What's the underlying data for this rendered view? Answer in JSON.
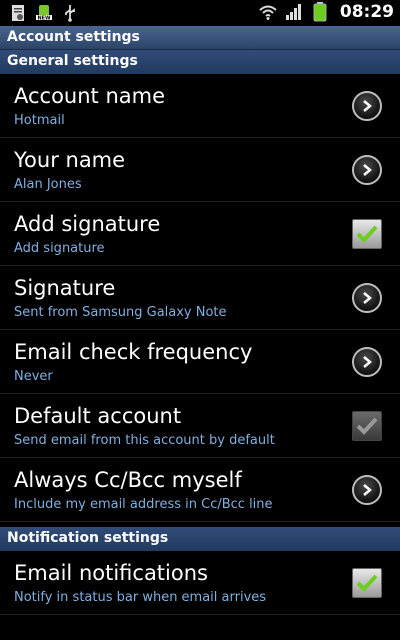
{
  "status_bar": {
    "time": "08:29",
    "left_icons": [
      "document-icon",
      "news-icon",
      "usb-icon"
    ],
    "right_icons": [
      "wifi-icon",
      "signal-icon",
      "battery-icon"
    ]
  },
  "app_bar": {
    "title": "Account settings"
  },
  "sections": [
    {
      "header": "General settings"
    },
    {
      "header": "Notification settings"
    }
  ],
  "settings": [
    {
      "title": "Account name",
      "subtitle": "Hotmail",
      "control": "chevron"
    },
    {
      "title": "Your name",
      "subtitle": "Alan Jones",
      "control": "chevron"
    },
    {
      "title": "Add signature",
      "subtitle": "Add signature",
      "control": "checkbox",
      "checked": true
    },
    {
      "title": "Signature",
      "subtitle": "Sent from Samsung Galaxy Note",
      "control": "chevron"
    },
    {
      "title": "Email check frequency",
      "subtitle": "Never",
      "control": "chevron"
    },
    {
      "title": "Default account",
      "subtitle": "Send email from this account by default",
      "control": "checkbox",
      "checked": true,
      "disabled": true
    },
    {
      "title": "Always Cc/Bcc myself",
      "subtitle": "Include my email address in Cc/Bcc line",
      "control": "chevron"
    },
    {
      "title": "Email notifications",
      "subtitle": "Notify in status bar when email arrives",
      "control": "checkbox",
      "checked": true
    }
  ],
  "colors": {
    "accent_blue": "#7fb0e0",
    "header_blue": "#2c4468",
    "check_green": "#6ccf1d",
    "battery_green": "#6ccf1d"
  }
}
